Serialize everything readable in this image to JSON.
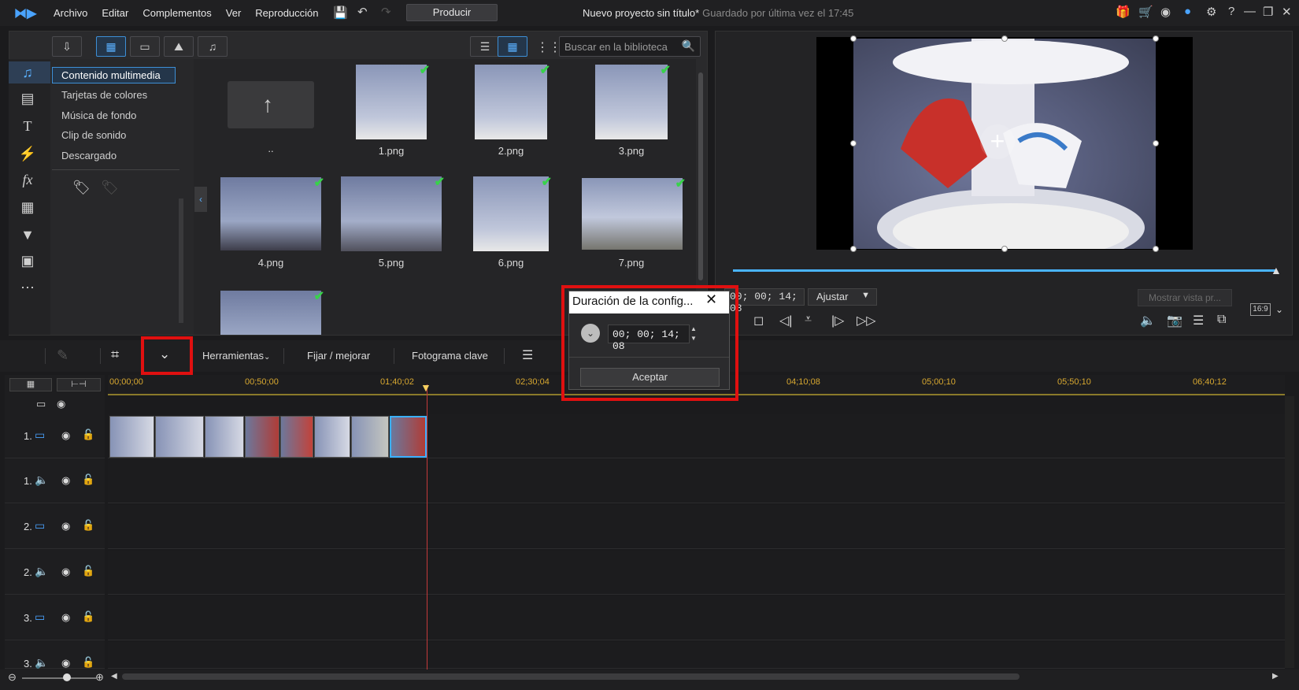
{
  "app": {
    "menu": [
      "Archivo",
      "Editar",
      "Complementos",
      "Ver",
      "Reproducción"
    ],
    "produce_label": "Producir",
    "project_title": "Nuevo proyecto sin título*",
    "saved_text": "Guardado por última vez el 17:45"
  },
  "library": {
    "search_placeholder": "Buscar en la biblioteca",
    "categories": [
      "Contenido multimedia",
      "Tarjetas de colores",
      "Música de fondo",
      "Clip de sonido",
      "Descargado"
    ],
    "up_folder_label": "..",
    "items": [
      "1.png",
      "2.png",
      "3.png",
      "4.png",
      "5.png",
      "6.png",
      "7.png"
    ]
  },
  "preview": {
    "timecode": "00; 00; 14; 08",
    "fit_label": "Ajustar",
    "show_preview_label": "Mostrar vista pr...",
    "aspect_ratio": "16:9"
  },
  "edit_toolbar": {
    "tools_label": "Herramientas",
    "fix_label": "Fijar / mejorar",
    "keyframe_label": "Fotograma clave"
  },
  "timeline": {
    "ruler_labels": [
      "00;00;00",
      "00;50;00",
      "01;40;02",
      "02;30;04",
      "04;10;08",
      "05;00;10",
      "05;50;10",
      "06;40;12"
    ],
    "tracks": [
      {
        "num": "1.",
        "type": "video"
      },
      {
        "num": "1.",
        "type": "audio"
      },
      {
        "num": "2.",
        "type": "video"
      },
      {
        "num": "2.",
        "type": "audio"
      },
      {
        "num": "3.",
        "type": "video"
      },
      {
        "num": "3.",
        "type": "audio"
      }
    ]
  },
  "dialog": {
    "title": "Duración de la config...",
    "value": "00; 00; 14; 08",
    "accept_label": "Aceptar"
  },
  "colors": {
    "accent": "#3d8fd6",
    "highlight_red": "#e01010",
    "ruler_text": "#d8a830"
  }
}
